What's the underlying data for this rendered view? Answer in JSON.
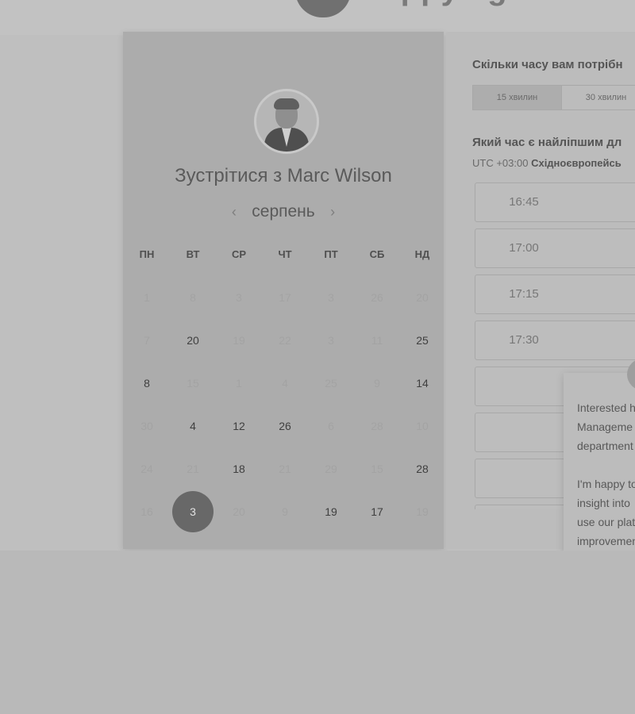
{
  "brand": {
    "logo_text": "happysignals"
  },
  "host": {
    "title": "Зустрітися з Marc Wilson"
  },
  "calendar": {
    "month": "серпень",
    "prev_arrow": "‹",
    "next_arrow": "›",
    "weekdays": [
      "ПН",
      "ВТ",
      "СР",
      "ЧТ",
      "ПТ",
      "СБ",
      "НД"
    ],
    "weeks": [
      [
        {
          "d": "1",
          "s": "muted"
        },
        {
          "d": "8",
          "s": "muted"
        },
        {
          "d": "3",
          "s": "muted"
        },
        {
          "d": "17",
          "s": "muted"
        },
        {
          "d": "3",
          "s": "muted"
        },
        {
          "d": "26",
          "s": "muted"
        },
        {
          "d": "20",
          "s": "muted"
        }
      ],
      [
        {
          "d": "7",
          "s": "muted"
        },
        {
          "d": "20",
          "s": "active"
        },
        {
          "d": "19",
          "s": "muted"
        },
        {
          "d": "22",
          "s": "muted"
        },
        {
          "d": "3",
          "s": "muted"
        },
        {
          "d": "11",
          "s": "muted"
        },
        {
          "d": "25",
          "s": "active"
        }
      ],
      [
        {
          "d": "8",
          "s": "active"
        },
        {
          "d": "15",
          "s": "muted"
        },
        {
          "d": "1",
          "s": "muted"
        },
        {
          "d": "4",
          "s": "muted"
        },
        {
          "d": "25",
          "s": "muted"
        },
        {
          "d": "9",
          "s": "muted"
        },
        {
          "d": "14",
          "s": "active"
        }
      ],
      [
        {
          "d": "30",
          "s": "muted"
        },
        {
          "d": "4",
          "s": "active"
        },
        {
          "d": "12",
          "s": "active"
        },
        {
          "d": "26",
          "s": "active"
        },
        {
          "d": "6",
          "s": "muted"
        },
        {
          "d": "28",
          "s": "muted"
        },
        {
          "d": "10",
          "s": "muted"
        }
      ],
      [
        {
          "d": "24",
          "s": "muted"
        },
        {
          "d": "21",
          "s": "muted"
        },
        {
          "d": "18",
          "s": "active"
        },
        {
          "d": "21",
          "s": "muted"
        },
        {
          "d": "29",
          "s": "muted"
        },
        {
          "d": "15",
          "s": "muted"
        },
        {
          "d": "28",
          "s": "active"
        }
      ],
      [
        {
          "d": "16",
          "s": "muted"
        },
        {
          "d": "3",
          "s": "selected"
        },
        {
          "d": "20",
          "s": "muted"
        },
        {
          "d": "9",
          "s": "muted"
        },
        {
          "d": "19",
          "s": "active"
        },
        {
          "d": "17",
          "s": "active"
        },
        {
          "d": "19",
          "s": "muted"
        }
      ]
    ]
  },
  "scheduler": {
    "duration_question": "Скільки часу вам потрібн",
    "durations": [
      {
        "label": "15 хвилин",
        "active": true
      },
      {
        "label": "30 хвилин",
        "active": false
      }
    ],
    "time_question": "Який час є найліпшим дл",
    "timezone_prefix": "UTC +03:00",
    "timezone_name": "Східноєвропейсь",
    "slots": [
      "16:45",
      "17:00",
      "17:15",
      "17:30",
      "",
      "",
      "",
      ""
    ]
  },
  "chat": {
    "paragraph_1": "Interested h\nManageme\ndepartment",
    "paragraph_2": "I'm happy to\ninsight into\nuse our plat\nimprovemen\nproductivity"
  },
  "colors": {
    "selected_day": "#686868",
    "panel": "#acacac",
    "background": "#b9b9b9"
  }
}
